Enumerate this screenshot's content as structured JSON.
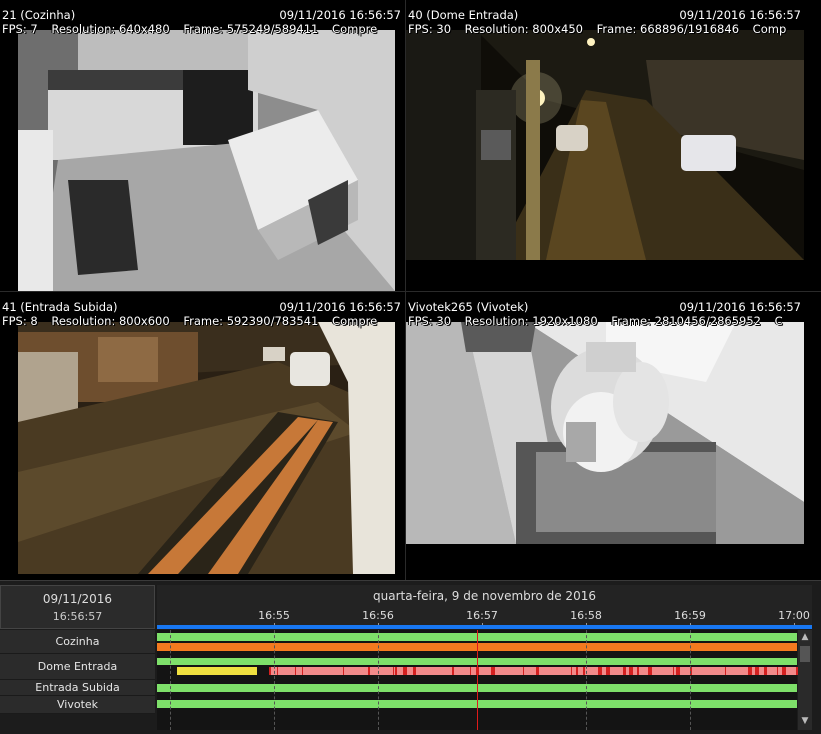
{
  "cameras": [
    {
      "id": "cam-cozinha",
      "title": "21 (Cozinha)",
      "timestamp": "09/11/2016 16:56:57",
      "fps": "FPS: 7",
      "resolution": "Resolution: 640x480",
      "frame": "Frame: 575249/589411",
      "extra": "Compre"
    },
    {
      "id": "cam-dome",
      "title": "40 (Dome Entrada)",
      "timestamp": "09/11/2016 16:56:57",
      "fps": "FPS: 30",
      "resolution": "Resolution: 800x450",
      "frame": "Frame: 668896/1916846",
      "extra": "Comp"
    },
    {
      "id": "cam-subida",
      "title": "41 (Entrada Subida)",
      "timestamp": "09/11/2016 16:56:57",
      "fps": "FPS: 8",
      "resolution": "Resolution: 800x600",
      "frame": "Frame: 592390/783541",
      "extra": "Compre"
    },
    {
      "id": "cam-vivotek",
      "title": "Vivotek265 (Vivotek)",
      "timestamp": "09/11/2016 16:56:57",
      "fps": "FPS: 30",
      "resolution": "Resolution: 1920x1080",
      "frame": "Frame: 2810456/2865952",
      "extra": "C"
    }
  ],
  "timeline": {
    "date": "09/11/2016",
    "time": "16:56:57",
    "day_label": "quarta-feira, 9 de novembro de 2016",
    "ticks": [
      "16:55",
      "16:56",
      "16:57",
      "16:58",
      "16:59",
      "17:00"
    ],
    "tracks": [
      "Cozinha",
      "Dome Entrada",
      "Entrada Subida",
      "Vivotek"
    ],
    "scroll_up": "▲",
    "scroll_down": "▼"
  },
  "colors": {
    "recording": "#7ee06a",
    "motion": "#f47a1f",
    "alarm": "#e84a4a",
    "event": "#f0e040",
    "cursor": "#e01a1a",
    "accent": "#1877f2"
  }
}
